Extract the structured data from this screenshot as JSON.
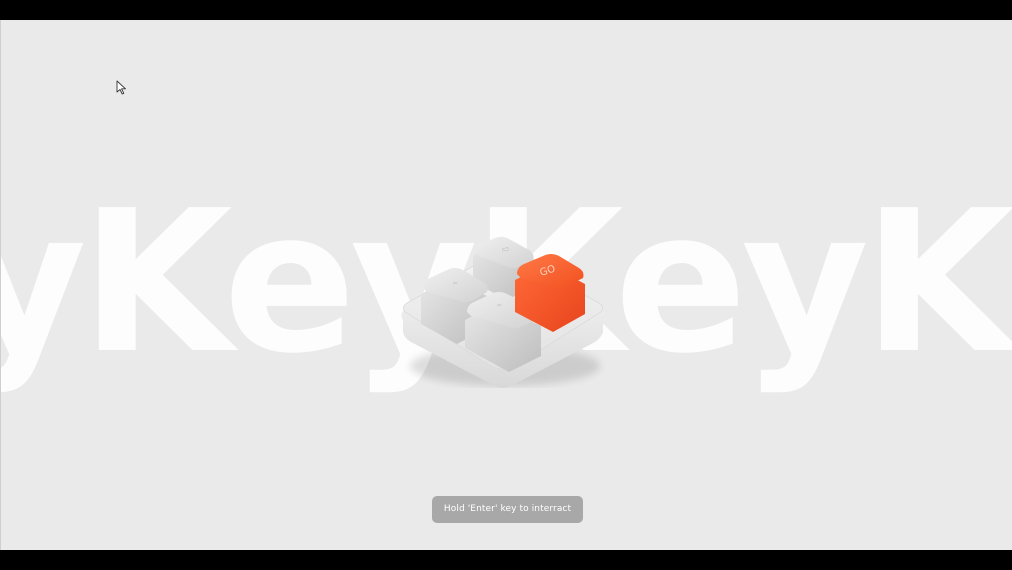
{
  "background_wordmark": "yKeyKeyKey",
  "keypad": {
    "keys": [
      {
        "label": "",
        "name": "key-top"
      },
      {
        "label": "",
        "name": "key-left"
      },
      {
        "label": "",
        "name": "key-bottom"
      },
      {
        "label": "GO",
        "name": "key-go"
      }
    ],
    "accent_color": "#ff5a2a",
    "key_color": "#d9d9d9"
  },
  "hint": {
    "label": "Hold 'Enter' key to interract"
  },
  "colors": {
    "background": "#eaeaea",
    "hint_bg": "#a8a8a8",
    "letterbox": "#000000"
  }
}
